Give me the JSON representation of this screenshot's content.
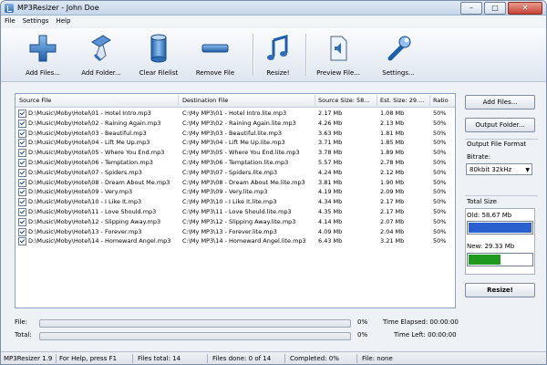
{
  "window": {
    "title": "MP3Resizer - John Doe"
  },
  "menu": [
    "File",
    "Settings",
    "Help"
  ],
  "toolbar": {
    "add_files": "Add Files...",
    "add_folder": "Add Folder...",
    "clear_filelist": "Clear Filelist",
    "remove_file": "Remove File",
    "resize": "Resize!",
    "preview_file": "Preview File...",
    "settings": "Settings..."
  },
  "table": {
    "columns": [
      "Source File",
      "Destination File",
      "Source Size: 58...",
      "Est. Size: 29....",
      "Ratio"
    ],
    "rows": [
      {
        "src": "D:\\Music\\Moby\\Hotel\\01 - Hotel Intro.mp3",
        "dst": "C:\\My MP3\\01 - Hotel Intro.lite.mp3",
        "src_size": "2.17 Mb",
        "est_size": "1.08 Mb",
        "ratio": "50%"
      },
      {
        "src": "D:\\Music\\Moby\\Hotel\\02 - Raining Again.mp3",
        "dst": "C:\\My MP3\\02 - Raining Again.lite.mp3",
        "src_size": "4.26 Mb",
        "est_size": "2.13 Mb",
        "ratio": "50%"
      },
      {
        "src": "D:\\Music\\Moby\\Hotel\\03 - Beautiful.mp3",
        "dst": "C:\\My MP3\\03 - Beautiful.lite.mp3",
        "src_size": "3.63 Mb",
        "est_size": "1.81 Mb",
        "ratio": "50%"
      },
      {
        "src": "D:\\Music\\Moby\\Hotel\\04 - Lift Me Up.mp3",
        "dst": "C:\\My MP3\\04 - Lift Me Up.lite.mp3",
        "src_size": "3.71 Mb",
        "est_size": "1.85 Mb",
        "ratio": "50%"
      },
      {
        "src": "D:\\Music\\Moby\\Hotel\\05 - Where You End.mp3",
        "dst": "C:\\My MP3\\05 - Where You End.lite.mp3",
        "src_size": "3.78 Mb",
        "est_size": "1.89 Mb",
        "ratio": "50%"
      },
      {
        "src": "D:\\Music\\Moby\\Hotel\\06 - Temptation.mp3",
        "dst": "C:\\My MP3\\06 - Temptation.lite.mp3",
        "src_size": "5.57 Mb",
        "est_size": "2.78 Mb",
        "ratio": "50%"
      },
      {
        "src": "D:\\Music\\Moby\\Hotel\\07 - Spiders.mp3",
        "dst": "C:\\My MP3\\07 - Spiders.lite.mp3",
        "src_size": "4.24 Mb",
        "est_size": "2.12 Mb",
        "ratio": "50%"
      },
      {
        "src": "D:\\Music\\Moby\\Hotel\\08 - Dream About Me.mp3",
        "dst": "C:\\My MP3\\08 - Dream About Me.lite.mp3",
        "src_size": "3.81 Mb",
        "est_size": "1.90 Mb",
        "ratio": "50%"
      },
      {
        "src": "D:\\Music\\Moby\\Hotel\\09 - Very.mp3",
        "dst": "C:\\My MP3\\09 - Very.lite.mp3",
        "src_size": "4.19 Mb",
        "est_size": "2.09 Mb",
        "ratio": "50%"
      },
      {
        "src": "D:\\Music\\Moby\\Hotel\\10 - I Like It.mp3",
        "dst": "C:\\My MP3\\10 - I Like It.lite.mp3",
        "src_size": "4.34 Mb",
        "est_size": "2.17 Mb",
        "ratio": "50%"
      },
      {
        "src": "D:\\Music\\Moby\\Hotel\\11 - Love Should.mp3",
        "dst": "C:\\My MP3\\11 - Love Should.lite.mp3",
        "src_size": "4.35 Mb",
        "est_size": "2.17 Mb",
        "ratio": "50%"
      },
      {
        "src": "D:\\Music\\Moby\\Hotel\\12 - Slipping Away.mp3",
        "dst": "C:\\My MP3\\12 - Slipping Away.lite.mp3",
        "src_size": "4.14 Mb",
        "est_size": "2.07 Mb",
        "ratio": "50%"
      },
      {
        "src": "D:\\Music\\Moby\\Hotel\\13 - Forever.mp3",
        "dst": "C:\\My MP3\\13 - Forever.lite.mp3",
        "src_size": "4.09 Mb",
        "est_size": "2.04 Mb",
        "ratio": "50%"
      },
      {
        "src": "D:\\Music\\Moby\\Hotel\\14 - Homeward Angel.mp3",
        "dst": "C:\\My MP3\\14 - Homeward Angel.lite.mp3",
        "src_size": "6.43 Mb",
        "est_size": "3.21 Mb",
        "ratio": "50%"
      }
    ]
  },
  "side": {
    "add_files": "Add Files...",
    "output_folder": "Output Folder...",
    "output_format": "Output File Format",
    "bitrate_label": "Bitrate:",
    "bitrate_value": "80kbit 32kHz",
    "total_size": "Total Size",
    "old_label": "Old: 58.67 Mb",
    "new_label": "New: 29.33 Mb",
    "old_fill": 1.0,
    "new_fill": 0.5,
    "resize": "Resize!"
  },
  "progress": {
    "file_label": "File:",
    "total_label": "Total:",
    "file_pct": "0%",
    "total_pct": "0%",
    "time_elapsed": "Time Elapsed: 00:00:00",
    "time_left": "Time Left: 00:00:00"
  },
  "status": {
    "version": "MP3Resizer 1.9",
    "help": "For Help, press F1",
    "files_total": "Files total: 14",
    "files_done": "Files done: 0 of 14",
    "completed": "Completed:  0%",
    "file": "File: none"
  },
  "colors": {
    "old_bar": "#2a5fd0",
    "new_bar": "#1f9a1f",
    "accent": "#3a7bd5"
  }
}
